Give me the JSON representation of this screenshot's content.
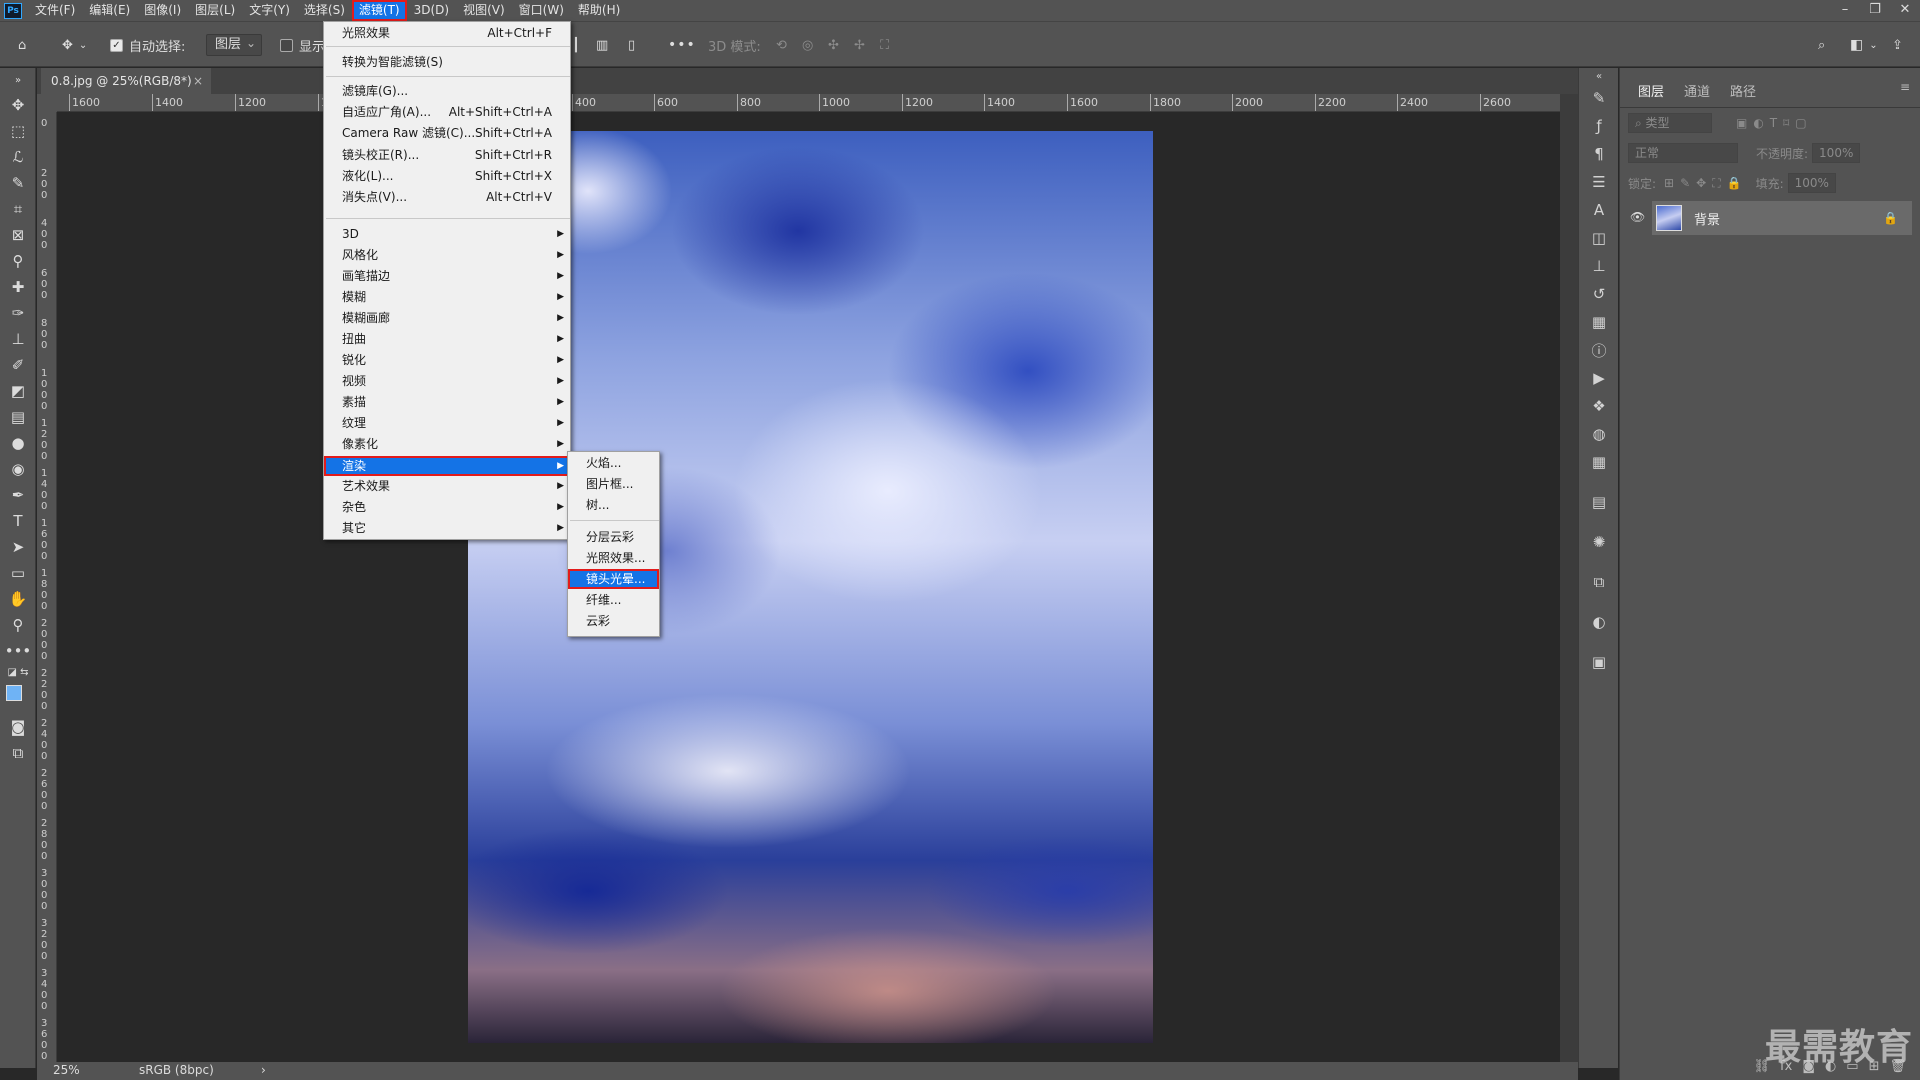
{
  "menubar": {
    "logo": "Ps",
    "items": [
      "文件(F)",
      "编辑(E)",
      "图像(I)",
      "图层(L)",
      "文字(Y)",
      "选择(S)",
      "滤镜(T)",
      "3D(D)",
      "视图(V)",
      "窗口(W)",
      "帮助(H)"
    ],
    "window_controls": [
      "–",
      "❐",
      "✕"
    ]
  },
  "options": {
    "auto_select_label": "自动选择:",
    "auto_select_target": "图层",
    "show_label": "显示",
    "mode_label": "3D 模式:",
    "more": "•••"
  },
  "document": {
    "tab_title": "0.8.jpg @ 25%(RGB/8*)",
    "close": "×",
    "hruler_ticks": [
      "1600",
      "1400",
      "1200",
      "1000",
      "800",
      "400",
      "600",
      "800",
      "1000",
      "1200",
      "1400",
      "1600",
      "1800",
      "2000",
      "2200",
      "2400",
      "2600",
      "2800",
      "3000",
      "3200",
      "3400",
      "3600",
      "3800",
      "4000",
      "4200"
    ],
    "vruler_ticks": [
      "0",
      "200",
      "400",
      "600",
      "800",
      "1000",
      "1200",
      "1400",
      "1600",
      "1800",
      "2000",
      "2200",
      "2400",
      "2600",
      "2800",
      "3000",
      "3200",
      "3400",
      "3600"
    ]
  },
  "filter_menu": {
    "top": [
      {
        "label": "光照效果",
        "shortcut": "Alt+Ctrl+F"
      }
    ],
    "smart": {
      "label": "转换为智能滤镜(S)"
    },
    "group1": [
      {
        "label": "滤镜库(G)...",
        "shortcut": ""
      },
      {
        "label": "自适应广角(A)...",
        "shortcut": "Alt+Shift+Ctrl+A"
      },
      {
        "label": "Camera Raw 滤镜(C)...",
        "shortcut": "Shift+Ctrl+A"
      },
      {
        "label": "镜头校正(R)...",
        "shortcut": "Shift+Ctrl+R"
      },
      {
        "label": "液化(L)...",
        "shortcut": "Shift+Ctrl+X"
      },
      {
        "label": "消失点(V)...",
        "shortcut": "Alt+Ctrl+V"
      }
    ],
    "submenus": [
      "3D",
      "风格化",
      "画笔描边",
      "模糊",
      "模糊画廊",
      "扭曲",
      "锐化",
      "视频",
      "素描",
      "纹理",
      "像素化",
      "渲染",
      "艺术效果",
      "杂色",
      "其它"
    ],
    "highlighted": "渲染"
  },
  "render_submenu": {
    "items_a": [
      "火焰...",
      "图片框...",
      "树..."
    ],
    "items_b": [
      "分层云彩",
      "光照效果...",
      "镜头光晕...",
      "纤维...",
      "云彩"
    ],
    "highlighted": "镜头光晕..."
  },
  "layers_panel": {
    "tabs": [
      "图层",
      "通道",
      "路径"
    ],
    "filter_placeholder": "类型",
    "blend_mode": "正常",
    "opacity_label": "不透明度:",
    "opacity_value": "100%",
    "lock_label": "锁定:",
    "fill_label": "填充:",
    "fill_value": "100%",
    "layer_name": "背景"
  },
  "status": {
    "zoom": "25%",
    "profile": "sRGB (8bpc)",
    "arrow": "›"
  },
  "watermark": "最需教育"
}
